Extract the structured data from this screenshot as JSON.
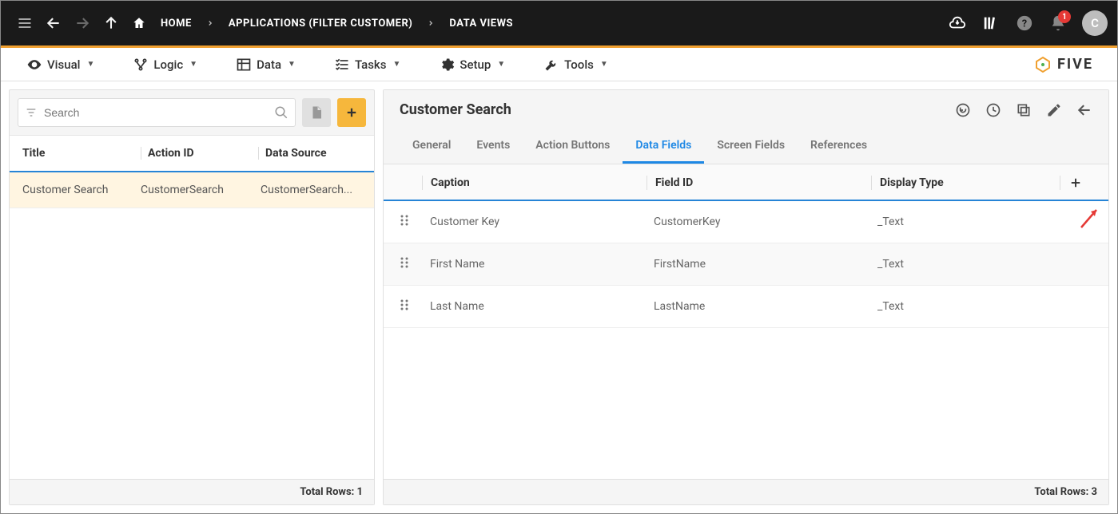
{
  "topbar": {
    "breadcrumbs": [
      "HOME",
      "APPLICATIONS (FILTER CUSTOMER)",
      "DATA VIEWS"
    ],
    "avatar_letter": "C",
    "notification_count": "1"
  },
  "menubar": {
    "items": [
      {
        "label": "Visual"
      },
      {
        "label": "Logic"
      },
      {
        "label": "Data"
      },
      {
        "label": "Tasks"
      },
      {
        "label": "Setup"
      },
      {
        "label": "Tools"
      }
    ],
    "brand": "FIVE"
  },
  "left": {
    "search_placeholder": "Search",
    "headers": {
      "title": "Title",
      "action_id": "Action ID",
      "data_source": "Data Source"
    },
    "rows": [
      {
        "title": "Customer Search",
        "action_id": "CustomerSearch",
        "data_source": "CustomerSearch..."
      }
    ],
    "footer": "Total Rows: 1"
  },
  "right": {
    "title": "Customer Search",
    "tabs": [
      "General",
      "Events",
      "Action Buttons",
      "Data Fields",
      "Screen Fields",
      "References"
    ],
    "active_tab_index": 3,
    "table": {
      "headers": {
        "caption": "Caption",
        "field_id": "Field ID",
        "display_type": "Display Type"
      },
      "rows": [
        {
          "caption": "Customer Key",
          "field_id": "CustomerKey",
          "display_type": "_Text"
        },
        {
          "caption": "First Name",
          "field_id": "FirstName",
          "display_type": "_Text"
        },
        {
          "caption": "Last Name",
          "field_id": "LastName",
          "display_type": "_Text"
        }
      ]
    },
    "footer": "Total Rows: 3"
  }
}
